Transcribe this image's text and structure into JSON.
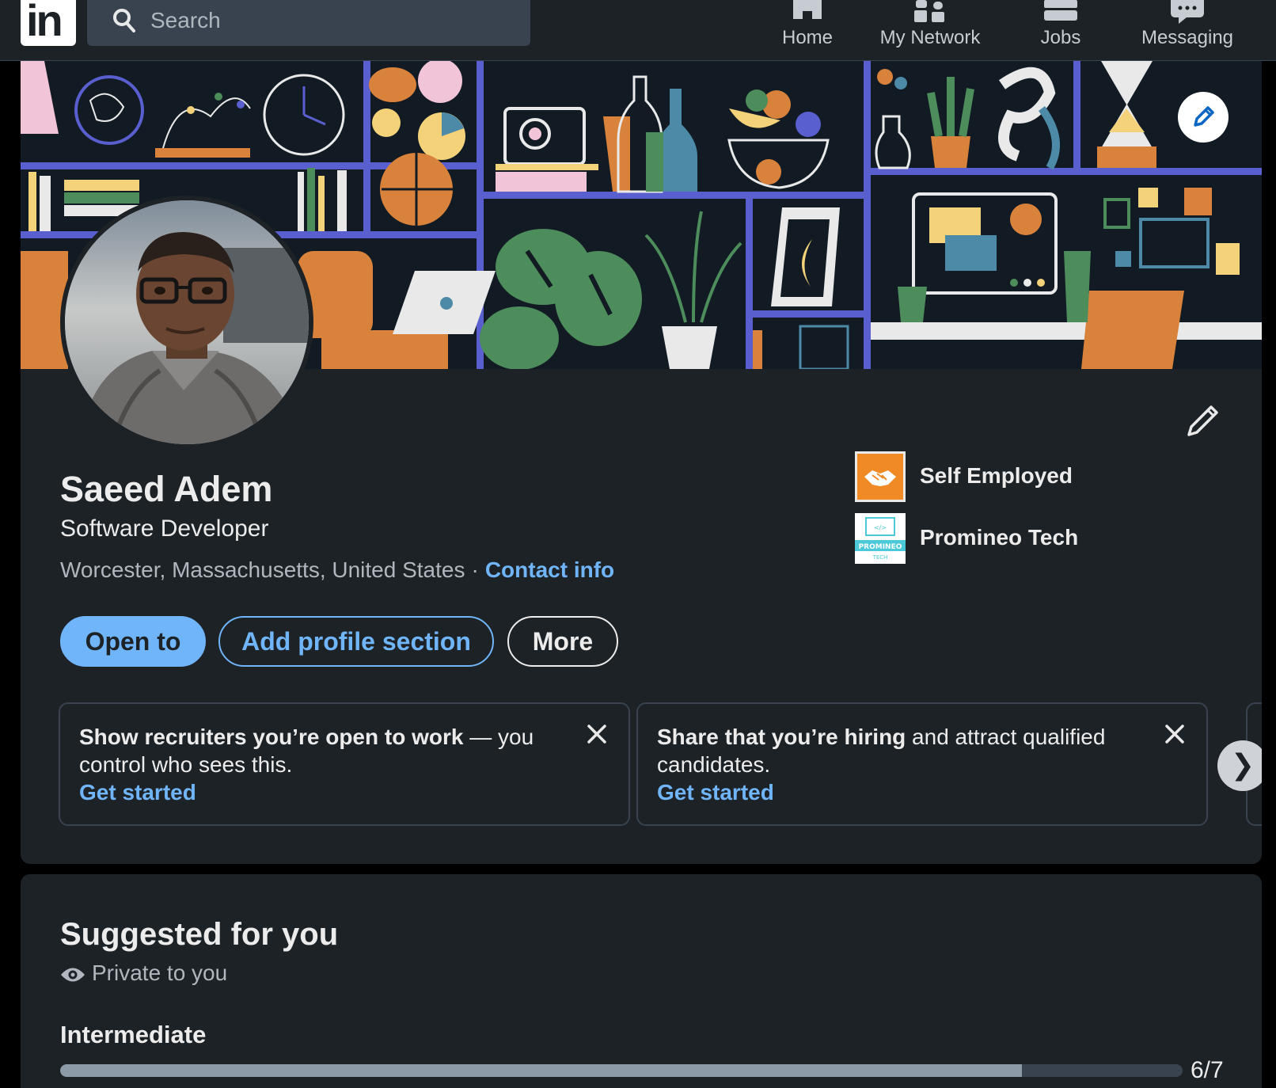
{
  "nav": {
    "logo_text": "in",
    "search_placeholder": "Search",
    "items": [
      {
        "label": "Home",
        "icon": "home-icon"
      },
      {
        "label": "My Network",
        "icon": "network-icon"
      },
      {
        "label": "Jobs",
        "icon": "jobs-icon"
      },
      {
        "label": "Messaging",
        "icon": "messaging-icon"
      }
    ]
  },
  "profile": {
    "name": "Saeed Adem",
    "headline": "Software Developer",
    "location": "Worcester, Massachusetts, United States",
    "separator": "·",
    "contact_info": "Contact info",
    "experience": [
      {
        "name": "Self Employed",
        "logo": "handshake-logo",
        "color": "#f08a24"
      },
      {
        "name": "Promineo Tech",
        "logo": "promineo-logo",
        "logo_text": "PROMINEO",
        "logo_subtext": "TECH",
        "color": "#4cc9d9"
      }
    ],
    "actions": {
      "open_to": "Open to",
      "add_section": "Add profile section",
      "more": "More"
    },
    "promos": [
      {
        "bold": "Show recruiters you’re open to work",
        "rest": " — you control who sees this.",
        "link": "Get started"
      },
      {
        "bold": "Share that you’re hiring",
        "rest": " and attract qualified candidates.",
        "link": "Get started"
      }
    ]
  },
  "suggested": {
    "title": "Suggested for you",
    "privacy": "Private to you",
    "level": "Intermediate",
    "progress_text": "6/7",
    "progress_fraction": 0.857
  },
  "colors": {
    "accent": "#70b5f9",
    "card_bg": "#1d2226",
    "page_bg": "#000000"
  }
}
